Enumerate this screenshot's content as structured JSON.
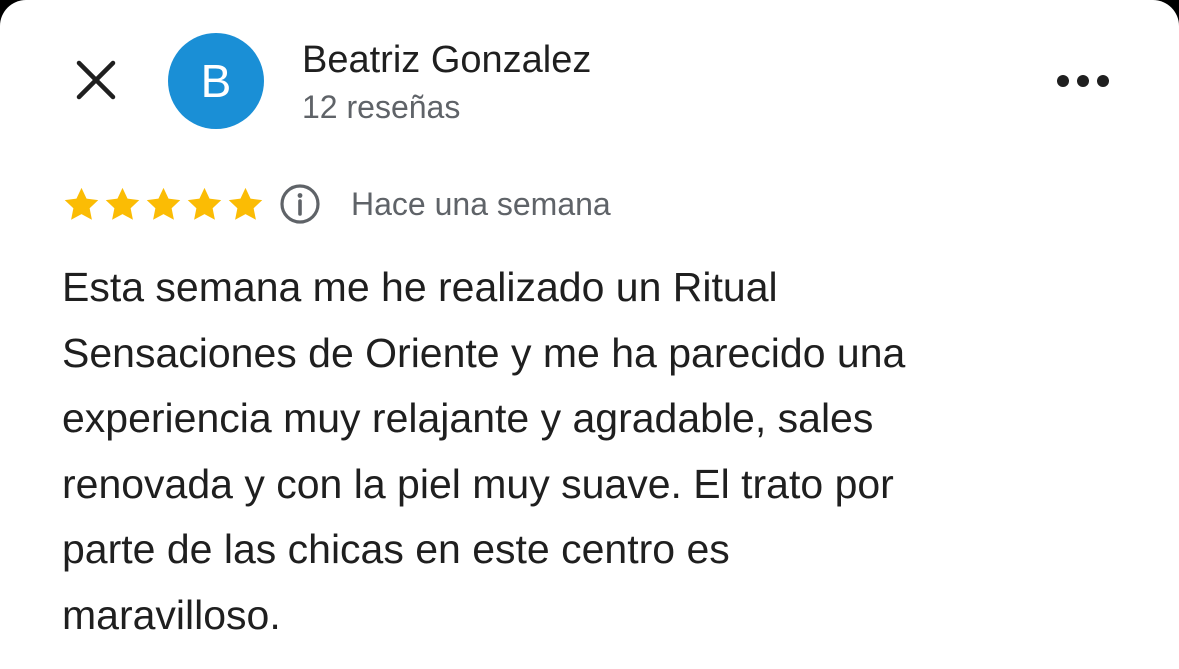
{
  "header": {
    "close_icon": "close-icon",
    "avatar_letter": "B",
    "avatar_color": "#1a8fd6",
    "reviewer_name": "Beatriz Gonzalez",
    "review_count": "12 reseñas",
    "more_icon": "more-horizontal-icon"
  },
  "review": {
    "rating": 5,
    "rating_max": 5,
    "star_color": "#fbbc04",
    "info_icon": "info-icon",
    "time_ago": "Hace una semana",
    "lines": [
      "Esta semana me he realizado un Ritual",
      "Sensaciones de Oriente y me ha parecido una",
      "experiencia muy relajante y agradable, sales",
      "renovada y con la piel muy suave. El trato por",
      "parte de las chicas en este centro es",
      "maravilloso."
    ]
  }
}
